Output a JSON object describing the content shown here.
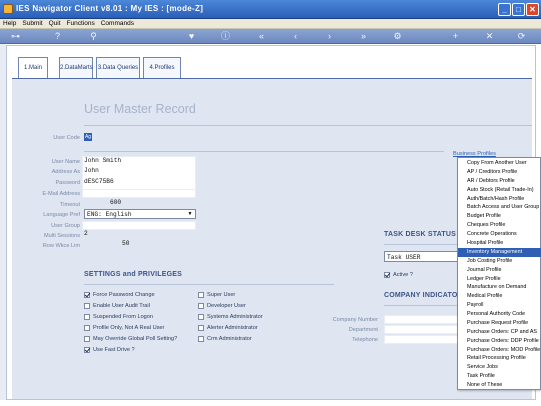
{
  "titlebar": {
    "title": "IES Navigator Client v8.01 : My IES :      [mode-Z]",
    "min": "_",
    "max": "□",
    "close": "✕"
  },
  "menubar": {
    "items": [
      "Help",
      "Submit",
      "Quit",
      "Functions",
      "Commands"
    ]
  },
  "toolbar": {
    "icons": [
      "key-icon",
      "help-icon",
      "search-icon",
      "heart-icon",
      "info-icon",
      "first-icon",
      "prev-icon",
      "next-icon",
      "last-icon",
      "settings-icon",
      "add-icon",
      "delete-icon",
      "refresh-icon"
    ],
    "glyphs": [
      "⊶",
      "?",
      "⚲",
      "♥",
      "ⓘ",
      "«",
      "‹",
      "›",
      "»",
      "⚙",
      "+",
      "✕",
      "⟳"
    ]
  },
  "tabs": [
    "1.Main",
    "2.DataMarts",
    "3.Data Queries",
    "4.Profiles"
  ],
  "page_title": "User Master Record",
  "fields": {
    "user_code_label": "User Code",
    "user_code_value": "Ag",
    "user_name_label": "User Name",
    "user_name_value": "John Smith",
    "address_as_label": "Address As",
    "address_as_value": "John",
    "password_label": "Password",
    "password_value": "dESC75B6",
    "email_label": "E-Mail Address",
    "timeout_label": "Timeout",
    "timeout_value": "600",
    "language_label": "Language Pref",
    "language_value": "ENG: English",
    "user_group_label": "User Group",
    "multi_sessions_label": "Multi Sessions",
    "multi_sessions_value": "2",
    "rows_label": "Row Wkce Lim",
    "rows_value": "50"
  },
  "settings": {
    "heading": "SETTINGS and PRIVILEGES",
    "left": [
      {
        "label": "Force Password Change",
        "checked": true
      },
      {
        "label": "Enable User Audit Trail",
        "checked": false
      },
      {
        "label": "Suspended From Logon",
        "checked": false
      },
      {
        "label": "Profile Only, Not A Real User",
        "checked": false
      },
      {
        "label": "May Override Global Poll Setting?",
        "checked": false
      },
      {
        "label": "Use Fast Drive ?",
        "checked": true
      }
    ],
    "right": [
      {
        "label": "Super User",
        "checked": false
      },
      {
        "label": "Developer User",
        "checked": false
      },
      {
        "label": "Systems Administrator",
        "checked": false
      },
      {
        "label": "Alerter Administrator",
        "checked": false
      },
      {
        "label": "Crm Administrator",
        "checked": false
      }
    ]
  },
  "task_desk": {
    "heading": "TASK DESK STATUS",
    "select_value": "Task USER",
    "active_label": "Active ?",
    "active_checked": true
  },
  "company": {
    "heading": "COMPANY INDICATORS",
    "company_number_label": "Company Number",
    "department_label": "Department",
    "telephone_label": "Telephone"
  },
  "business_profiles_link": "Business Profiles",
  "dropdown": {
    "items": [
      "Copy From Another User",
      "AP / Creditors Profile",
      "AR / Debtors Profile",
      "Auto Stock (Retail Trade-In)",
      "Auth/Batch/Hash Profile",
      "Batch Access and User Group",
      "Budget Profile",
      "Cheques Profile",
      "Concrete Operations",
      "Hospital Profile",
      "Inventory Management",
      "Job Costing Profile",
      "Journal Profile",
      "Ledger Profile",
      "Manufacture on Demand",
      "Medical Profile",
      "Payroll",
      "Personal Authority Code",
      "Purchase Request Profile",
      "Purchase Orders: CP and AS",
      "Purchase Orders: DDP Profile",
      "Purchase Orders: MOD Profile",
      "Retail Processing Profile",
      "Service Jobs",
      "Task Profile",
      "None of These"
    ],
    "highlighted_index": 10
  }
}
